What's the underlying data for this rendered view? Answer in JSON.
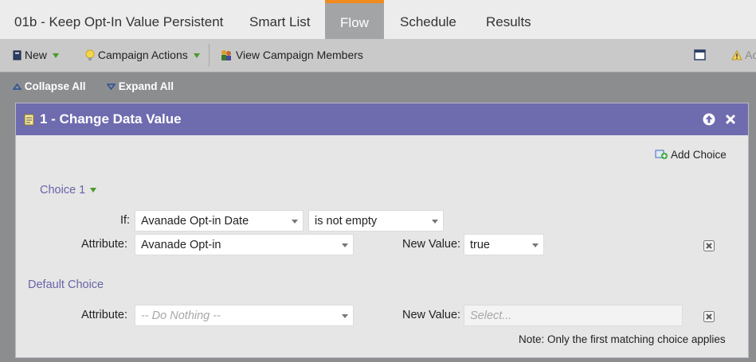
{
  "tabs": {
    "campaign_name": "01b - Keep Opt-In Value Persistent",
    "smart_list": "Smart List",
    "flow": "Flow",
    "schedule": "Schedule",
    "results": "Results",
    "active_accent": "#f08c1e"
  },
  "toolbar": {
    "new_label": "New",
    "campaign_actions_label": "Campaign Actions",
    "view_members_label": "View Campaign Members",
    "truncated_label": "Ac"
  },
  "flow_controls": {
    "collapse_all": "Collapse All",
    "expand_all": "Expand All"
  },
  "step": {
    "title": "1 - Change Data Value",
    "header_color": "#6f6baf",
    "add_choice": "Add Choice",
    "choice1": {
      "heading": "Choice 1",
      "if_label": "If:",
      "if_field": "Avanade Opt-in Date",
      "if_operator": "is not empty",
      "attribute_label": "Attribute:",
      "attribute_value": "Avanade Opt-in",
      "new_value_label": "New Value:",
      "new_value": "true"
    },
    "default_choice": {
      "heading": "Default Choice",
      "attribute_label": "Attribute:",
      "attribute_value": "-- Do Nothing --",
      "new_value_label": "New Value:",
      "new_value_placeholder": "Select..."
    },
    "note": "Note: Only the first matching choice applies"
  }
}
